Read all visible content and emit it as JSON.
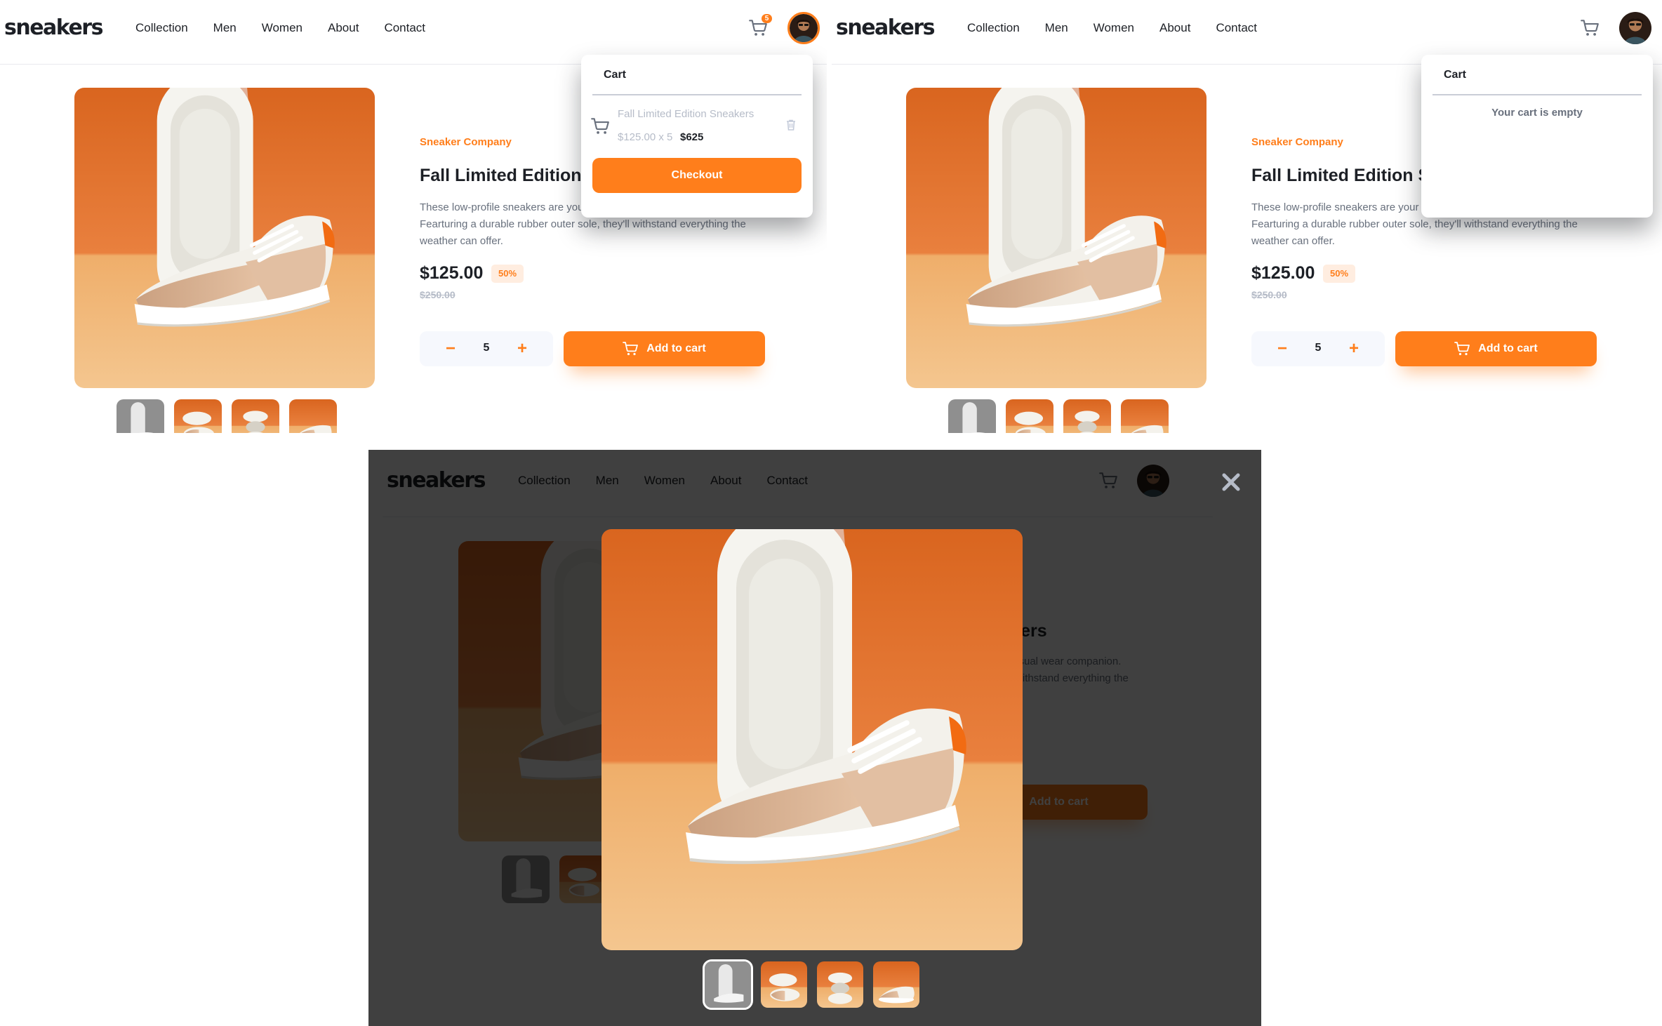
{
  "logo": "sneakers",
  "nav": [
    "Collection",
    "Men",
    "Women",
    "About",
    "Contact"
  ],
  "cart_badge": "5",
  "product": {
    "company": "Sneaker Company",
    "title": "Fall Limited Edition Sneakers",
    "description": "These low-profile sneakers are your perfect casual wear companion. Fearturing a durable rubber outer sole, they'll withstand everything the weather can offer.",
    "price": "$125.00",
    "discount": "50%",
    "old_price": "$250.00",
    "quantity": "5",
    "minus": "−",
    "plus": "+",
    "add_to_cart": "Add to cart"
  },
  "cart_filled": {
    "title": "Cart",
    "item_name": "Fall Limited Edition Sneakers",
    "item_calc": "$125.00 x 5",
    "item_total": "$625",
    "checkout": "Checkout"
  },
  "cart_empty": {
    "title": "Cart",
    "message": "Your cart is empty"
  },
  "lightbox": {
    "close": "×"
  },
  "icons": {
    "cart": "cart-icon",
    "trash": "trash-icon",
    "close": "close-icon",
    "avatar": "avatar"
  },
  "colors": {
    "orange": "#ff7e1b",
    "pale_orange": "#ffede0",
    "dark": "#1d2026",
    "grey": "#68707d",
    "light_grey": "#b6bcc8"
  }
}
